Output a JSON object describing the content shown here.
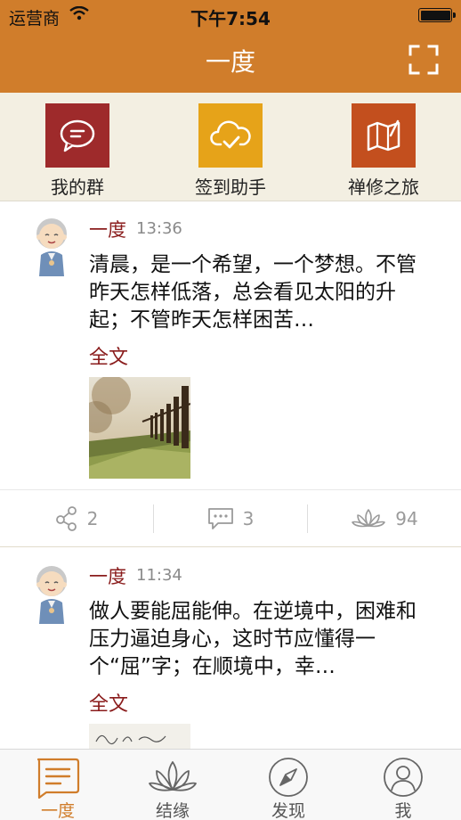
{
  "status_bar": {
    "carrier": "运营商",
    "time": "下午7:54"
  },
  "header": {
    "title": "一度"
  },
  "quick_actions": [
    {
      "label": "我的群",
      "icon": "chat-bubble-icon",
      "color": "#9e2a2b"
    },
    {
      "label": "签到助手",
      "icon": "cloud-check-icon",
      "color": "#e6a319"
    },
    {
      "label": "禅修之旅",
      "icon": "map-icon",
      "color": "#c34f1e"
    }
  ],
  "posts": [
    {
      "author": "一度",
      "time": "13:36",
      "text": "清晨，是一个希望，一个梦想。不管昨天怎样低落，总会看见太阳的升起；不管昨天怎样困苦…",
      "more": "全文",
      "share_count": "2",
      "comment_count": "3",
      "like_count": "94"
    },
    {
      "author": "一度",
      "time": "11:34",
      "text": "做人要能屈能伸。在逆境中，困难和压力逼迫身心，这时节应懂得一个“屈”字；在顺境中，幸…",
      "more": "全文"
    }
  ],
  "tabbar": [
    {
      "label": "一度",
      "icon": "document-icon",
      "active": true
    },
    {
      "label": "结缘",
      "icon": "lotus-icon",
      "active": false
    },
    {
      "label": "发现",
      "icon": "compass-icon",
      "active": false
    },
    {
      "label": "我",
      "icon": "user-icon",
      "active": false
    }
  ],
  "colors": {
    "accent": "#d07d2b",
    "author": "#8a1c1c",
    "quick_bg": "#f3efe2"
  }
}
